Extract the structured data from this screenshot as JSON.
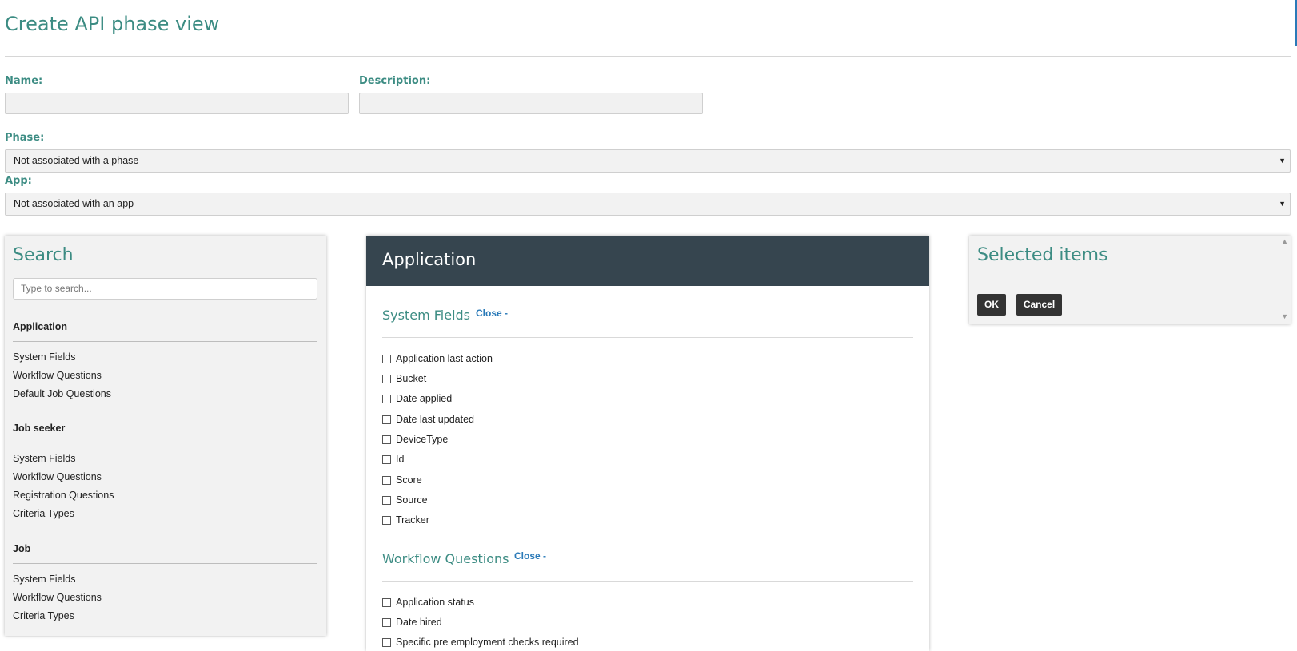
{
  "page": {
    "title": "Create API phase view"
  },
  "form": {
    "name_label": "Name:",
    "name_value": "",
    "description_label": "Description:",
    "description_value": "",
    "phase_label": "Phase:",
    "phase_value": "Not associated with a phase",
    "app_label": "App:",
    "app_value": "Not associated with an app"
  },
  "search_panel": {
    "title": "Search",
    "placeholder": "Type to search...",
    "groups": [
      {
        "heading": "Application",
        "items": [
          "System Fields",
          "Workflow Questions",
          "Default Job Questions"
        ]
      },
      {
        "heading": "Job seeker",
        "items": [
          "System Fields",
          "Workflow Questions",
          "Registration Questions",
          "Criteria Types"
        ]
      },
      {
        "heading": "Job",
        "items": [
          "System Fields",
          "Workflow Questions",
          "Criteria Types"
        ]
      }
    ]
  },
  "application_panel": {
    "title": "Application",
    "sections": [
      {
        "heading": "System Fields",
        "close_label": "Close -",
        "fields": [
          "Application last action",
          "Bucket",
          "Date applied",
          "Date last updated",
          "DeviceType",
          "Id",
          "Score",
          "Source",
          "Tracker"
        ]
      },
      {
        "heading": "Workflow Questions",
        "close_label": "Close -",
        "fields": [
          "Application status",
          "Date hired",
          "Specific pre employment checks required"
        ]
      }
    ]
  },
  "selected_panel": {
    "title": "Selected items",
    "ok_label": "OK",
    "cancel_label": "Cancel"
  },
  "icons": {
    "select_caret": "caret-down-icon",
    "scroll_up": "chevron-up-icon",
    "scroll_down": "chevron-down-icon"
  },
  "colors": {
    "accent": "#3c8c83",
    "header_bg": "#36454f",
    "link": "#2a7ab8",
    "button_bg": "#333333"
  }
}
